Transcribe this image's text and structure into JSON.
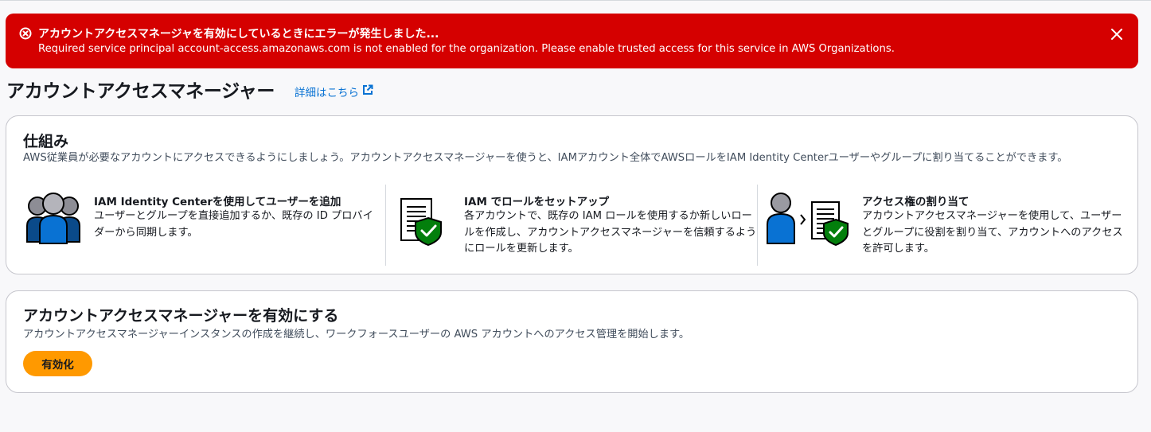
{
  "flashbar": {
    "type": "error",
    "title": "アカウントアクセスマネージャを有効にしているときにエラーが発生しました...",
    "message": "Required service principal account-access.amazonaws.com is not enabled for the organization. Please enable trusted access for this service in AWS Organizations.",
    "color": "#d50000"
  },
  "header": {
    "title": "アカウントアクセスマネージャー",
    "info_link": "詳細はこちら"
  },
  "how_it_works": {
    "title": "仕組み",
    "description": "AWS従業員が必要なアカウントにアクセスできるようにしましょう。アカウントアクセスマネージャーを使うと、IAMアカウント全体でAWSロールをIAM Identity Centerユーザーやグループに割り当てることができます。",
    "steps": [
      {
        "icon": "users-group-icon",
        "title": "IAM Identity Centerを使用してユーザーを追加",
        "text": "ユーザーとグループを直接追加するか、既存の ID プロバイダーから同期します。"
      },
      {
        "icon": "document-shield-icon",
        "title": "IAM でロールをセットアップ",
        "text": "各アカウントで、既存の IAM ロールを使用するか新しいロールを作成し、アカウントアクセスマネージャーを信頼するようにロールを更新します。"
      },
      {
        "icon": "user-to-document-icon",
        "title": "アクセス権の割り当て",
        "text": "アカウントアクセスマネージャーを使用して、ユーザーとグループに役割を割り当て、アカウントへのアクセスを許可します。"
      }
    ]
  },
  "enable": {
    "title": "アカウントアクセスマネージャーを有効にする",
    "description": "アカウントアクセスマネージャーインスタンスの作成を継続し、ワークフォースユーザーの AWS アカウントへのアクセス管理を開始します。",
    "button_label": "有効化",
    "button_color": "#ff9900"
  },
  "colors": {
    "link": "#0972d3",
    "icon_blue": "#0972d3",
    "icon_green": "#037f0c"
  }
}
